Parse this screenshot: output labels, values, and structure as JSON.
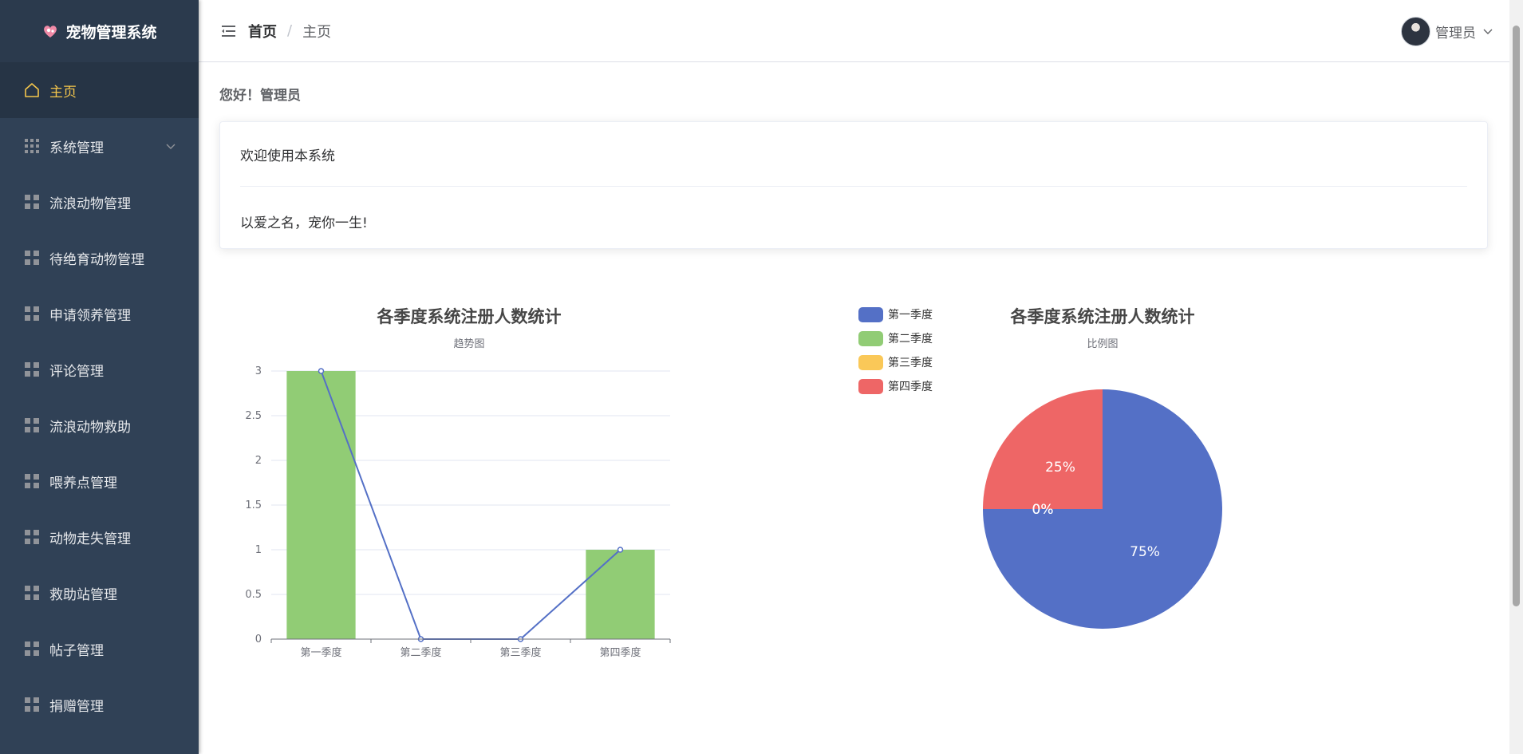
{
  "app": {
    "title": "宠物管理系统"
  },
  "sidebar": {
    "items": [
      {
        "label": "主页",
        "icon": "home-icon",
        "active": true
      },
      {
        "label": "系统管理",
        "icon": "grid-icon",
        "has_submenu": true
      },
      {
        "label": "流浪动物管理",
        "icon": "grid-icon"
      },
      {
        "label": "待绝育动物管理",
        "icon": "grid-icon"
      },
      {
        "label": "申请领养管理",
        "icon": "grid-icon"
      },
      {
        "label": "评论管理",
        "icon": "grid-icon"
      },
      {
        "label": "流浪动物救助",
        "icon": "grid-icon"
      },
      {
        "label": "喂养点管理",
        "icon": "grid-icon"
      },
      {
        "label": "动物走失管理",
        "icon": "grid-icon"
      },
      {
        "label": "救助站管理",
        "icon": "grid-icon"
      },
      {
        "label": "帖子管理",
        "icon": "grid-icon"
      },
      {
        "label": "捐赠管理",
        "icon": "grid-icon"
      }
    ]
  },
  "header": {
    "breadcrumb_home": "首页",
    "breadcrumb_sep": "/",
    "breadcrumb_current": "主页",
    "user_name": "管理员"
  },
  "main": {
    "greeting": "您好！管理员",
    "card_title": "欢迎使用本系统",
    "card_body": "以爱之名，宠你一生!"
  },
  "colors": {
    "sidebar_bg": "#304156",
    "active_text": "#f4c64c",
    "blue": "#5470c6",
    "green": "#91cc75",
    "yellow": "#fac858",
    "red": "#ee6666"
  },
  "chart_data": [
    {
      "type": "bar",
      "title": "各季度系统注册人数统计",
      "subtitle": "趋势图",
      "categories": [
        "第一季度",
        "第二季度",
        "第三季度",
        "第四季度"
      ],
      "series": [
        {
          "type": "bar",
          "values": [
            3,
            0,
            0,
            1
          ],
          "color": "#91cc75"
        },
        {
          "type": "line",
          "values": [
            3,
            0,
            0,
            1
          ],
          "color": "#5470c6"
        }
      ],
      "yticks": [
        "0",
        "0.5",
        "1",
        "1.5",
        "2",
        "2.5",
        "3"
      ],
      "ylim": [
        0,
        3
      ],
      "grid": true
    },
    {
      "type": "pie",
      "title": "各季度系统注册人数统计",
      "subtitle": "比例图",
      "legend_position": "top-left",
      "slices": [
        {
          "name": "第一季度",
          "value": 75,
          "label": "75%",
          "color": "#5470c6"
        },
        {
          "name": "第二季度",
          "value": 0,
          "label": "0%",
          "color": "#91cc75"
        },
        {
          "name": "第三季度",
          "value": 0,
          "label": "0%",
          "color": "#fac858"
        },
        {
          "name": "第四季度",
          "value": 25,
          "label": "25%",
          "color": "#ee6666"
        }
      ]
    }
  ]
}
